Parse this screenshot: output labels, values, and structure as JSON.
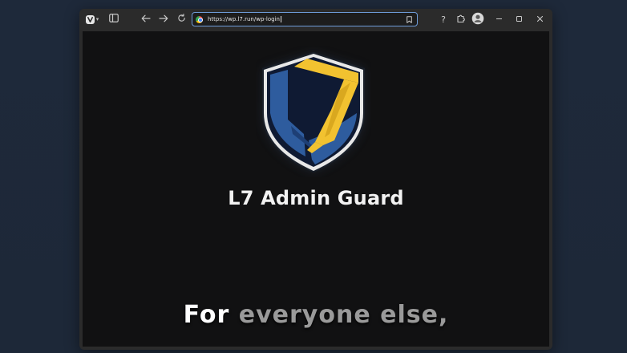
{
  "browser": {
    "address_bar": {
      "url": "https://wp.l7.run/wp-login"
    },
    "toolbar": {
      "help_label": "?"
    }
  },
  "page": {
    "brand_title": "L7 Admin Guard",
    "logo_mark": "L7"
  },
  "caption": {
    "bright": "For",
    "dim": "everyone else,"
  },
  "colors": {
    "shield_blue": "#2e5c9e",
    "shield_gold": "#f2c230",
    "shield_navy": "#0f1a33",
    "page_background": "#111112",
    "desktop_background": "#1e293a",
    "address_focus": "#6e9bd8"
  },
  "icons": {
    "browser_menu": "vivaldi-icon",
    "panel": "panel-icon",
    "back": "arrow-left-icon",
    "forward": "arrow-right-icon",
    "reload": "reload-icon",
    "site": "site-favicon-icon",
    "bookmark": "bookmark-icon",
    "extensions": "puzzle-icon",
    "profile": "user-icon",
    "minimize": "minimize-icon",
    "maximize": "maximize-icon",
    "close": "close-icon"
  }
}
